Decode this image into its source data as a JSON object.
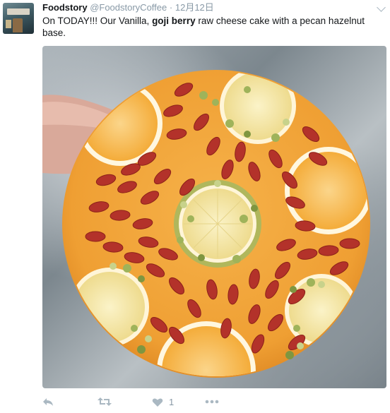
{
  "tweet": {
    "name": "Foodstory",
    "handle": "@FoodstoryCoffee",
    "separator": "·",
    "time": "12月12日",
    "text_before": "On TODAY!!! Our Vanilla, ",
    "text_bold": "goji berry",
    "text_after": " raw cheese cake with a pecan hazelnut base.",
    "like_count": "1"
  },
  "icons": {
    "reply": "reply-icon",
    "retweet": "retweet-icon",
    "like": "heart-icon",
    "more": "more-icon",
    "menu": "chevron-down-icon"
  },
  "colors": {
    "text": "#14171a",
    "muted": "#8899a6",
    "icon": "#aab8c2",
    "cake": "#f2a93b",
    "goji": "#b3322a",
    "orange": "#f7b84a",
    "lime": "#f3e6a0",
    "pistachio": "#9fb35a"
  }
}
